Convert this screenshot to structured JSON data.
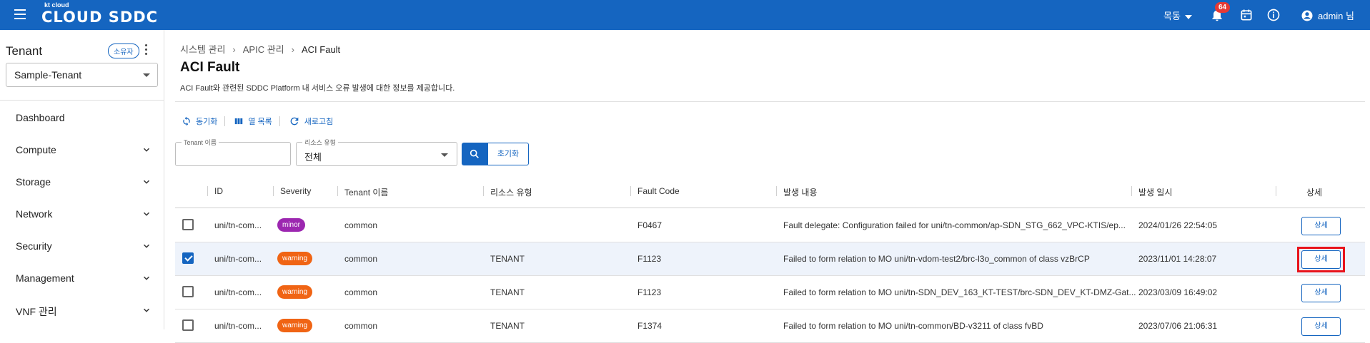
{
  "header": {
    "logo_small": "kt cloud",
    "logo_big": "CLOUD SDDC",
    "region": "목동",
    "notification_count": "64",
    "user": "admin 님"
  },
  "sidebar": {
    "title": "Tenant",
    "owner_badge": "소유자",
    "tenant_value": "Sample-Tenant",
    "items": [
      {
        "label": "Dashboard"
      },
      {
        "label": "Compute"
      },
      {
        "label": "Storage"
      },
      {
        "label": "Network"
      },
      {
        "label": "Security"
      },
      {
        "label": "Management"
      },
      {
        "label": "VNF 관리"
      }
    ]
  },
  "breadcrumb": [
    "시스템 관리",
    "APIC 관리",
    "ACI Fault"
  ],
  "page": {
    "title": "ACI Fault",
    "description": "ACI Fault와 관련된 SDDC Platform 내 서비스 오류 발생에 대한 정보를 제공합니다."
  },
  "toolbar": {
    "sync": "동기화",
    "columns": "열 목록",
    "refresh": "새로고침"
  },
  "filters": {
    "tenant_label": "Tenant 이름",
    "tenant_value": "",
    "resource_label": "리소스 유형",
    "resource_value": "전체",
    "reset": "초기화"
  },
  "table": {
    "headers": [
      "ID",
      "Severity",
      "Tenant 이름",
      "리소스 유형",
      "Fault Code",
      "발생 내용",
      "발생 일시",
      "상세"
    ],
    "rows": [
      {
        "id": "uni/tn-com...",
        "severity": "minor",
        "tenant": "common",
        "resource": "",
        "code": "F0467",
        "content": "Fault delegate: Configuration failed for uni/tn-common/ap-SDN_STG_662_VPC-KTIS/ep...",
        "time": "2024/01/26 22:54:05",
        "detail": "상세",
        "checked": false
      },
      {
        "id": "uni/tn-com...",
        "severity": "warning",
        "tenant": "common",
        "resource": "TENANT",
        "code": "F1123",
        "content": "Failed to form relation to MO uni/tn-vdom-test2/brc-l3o_common of class vzBrCP",
        "time": "2023/11/01 14:28:07",
        "detail": "상세",
        "checked": true
      },
      {
        "id": "uni/tn-com...",
        "severity": "warning",
        "tenant": "common",
        "resource": "TENANT",
        "code": "F1123",
        "content": "Failed to form relation to MO uni/tn-SDN_DEV_163_KT-TEST/brc-SDN_DEV_KT-DMZ-Gat...",
        "time": "2023/03/09 16:49:02",
        "detail": "상세",
        "checked": false
      },
      {
        "id": "uni/tn-com...",
        "severity": "warning",
        "tenant": "common",
        "resource": "TENANT",
        "code": "F1374",
        "content": "Failed to form relation to MO uni/tn-common/BD-v3211 of class fvBD",
        "time": "2023/07/06 21:06:31",
        "detail": "상세",
        "checked": false
      }
    ]
  },
  "colors": {
    "brand": "#1565c0",
    "minor": "#9c27b0",
    "warning": "#f06414",
    "highlight": "#e8141c"
  }
}
